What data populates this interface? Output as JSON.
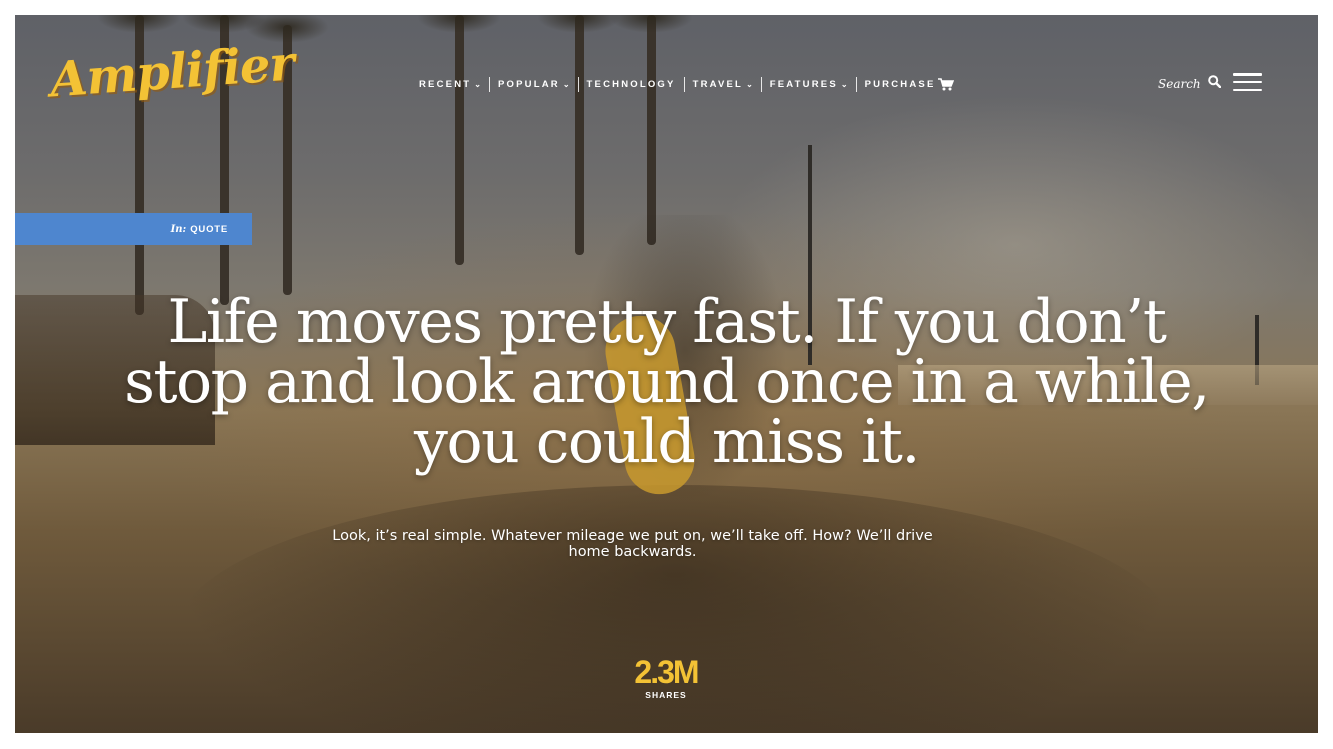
{
  "brand": {
    "logo_text": "Amplifier",
    "accent_color": "#f3c235"
  },
  "nav": {
    "items": [
      {
        "label": "RECENT",
        "has_dropdown": true
      },
      {
        "label": "POPULAR",
        "has_dropdown": true
      },
      {
        "label": "TECHNOLOGY",
        "has_dropdown": false
      },
      {
        "label": "TRAVEL",
        "has_dropdown": true
      },
      {
        "label": "FEATURES",
        "has_dropdown": true
      },
      {
        "label": "PURCHASE",
        "has_dropdown": false,
        "icon": "cart-icon"
      }
    ],
    "dropdown_icon": "chevron-down-icon"
  },
  "header": {
    "search_label": "Search",
    "search_icon": "search-icon",
    "menu_icon": "hamburger-menu-icon"
  },
  "post": {
    "category_prefix": "In:",
    "category": "QUOTE",
    "category_color": "#4e86cf",
    "quote": "Life moves pretty fast. If you don’t stop and look around once in a while, you could miss it.",
    "subtitle": "Look, it’s real simple. Whatever mileage we put on, we’ll take off. How? We’ll drive home backwards.",
    "shares_count": "2.3M",
    "shares_label": "SHARES"
  }
}
